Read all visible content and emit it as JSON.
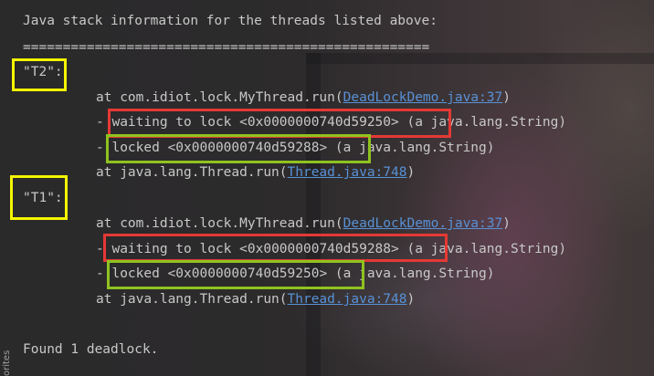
{
  "console": {
    "header": "Java stack information for the threads listed above:",
    "separator": "===================================================",
    "thread_t2": {
      "name": "\"T2\":",
      "frame1_prefix": "at com.idiot.lock.MyThread.run(",
      "frame1_link": "DeadLockDemo.java:37",
      "frame1_suffix": ")",
      "waiting_dash": "- ",
      "waiting_text": "waiting to lock <0x0000000740d59250>",
      "waiting_suffix": " (a java.lang.String)",
      "locked_dash": "- ",
      "locked_text": "locked <0x0000000740d59288>",
      "locked_suffix": " (a java.lang.String)",
      "frame2_prefix": "at java.lang.Thread.run(",
      "frame2_link": "Thread.java:748",
      "frame2_suffix": ")"
    },
    "thread_t1": {
      "name": "\"T1\":",
      "frame1_prefix": "at com.idiot.lock.MyThread.run(",
      "frame1_link": "DeadLockDemo.java:37",
      "frame1_suffix": ")",
      "waiting_dash": "- ",
      "waiting_text": "waiting to lock <0x0000000740d59288>",
      "waiting_suffix": " (a java.lang.String)",
      "locked_dash": "- ",
      "locked_text": "locked <0x0000000740d59250>",
      "locked_suffix": " (a java.lang.String)",
      "frame2_prefix": "at java.lang.Thread.run(",
      "frame2_link": "Thread.java:748",
      "frame2_suffix": ")"
    },
    "footer": "Found 1 deadlock."
  },
  "side_tab": {
    "label": "orites"
  },
  "colors": {
    "text": "#c8c8c8",
    "link": "#5891d6",
    "thread_box": "#f5f500",
    "waiting_box": "#e53935",
    "locked_box": "#8fc31f"
  }
}
